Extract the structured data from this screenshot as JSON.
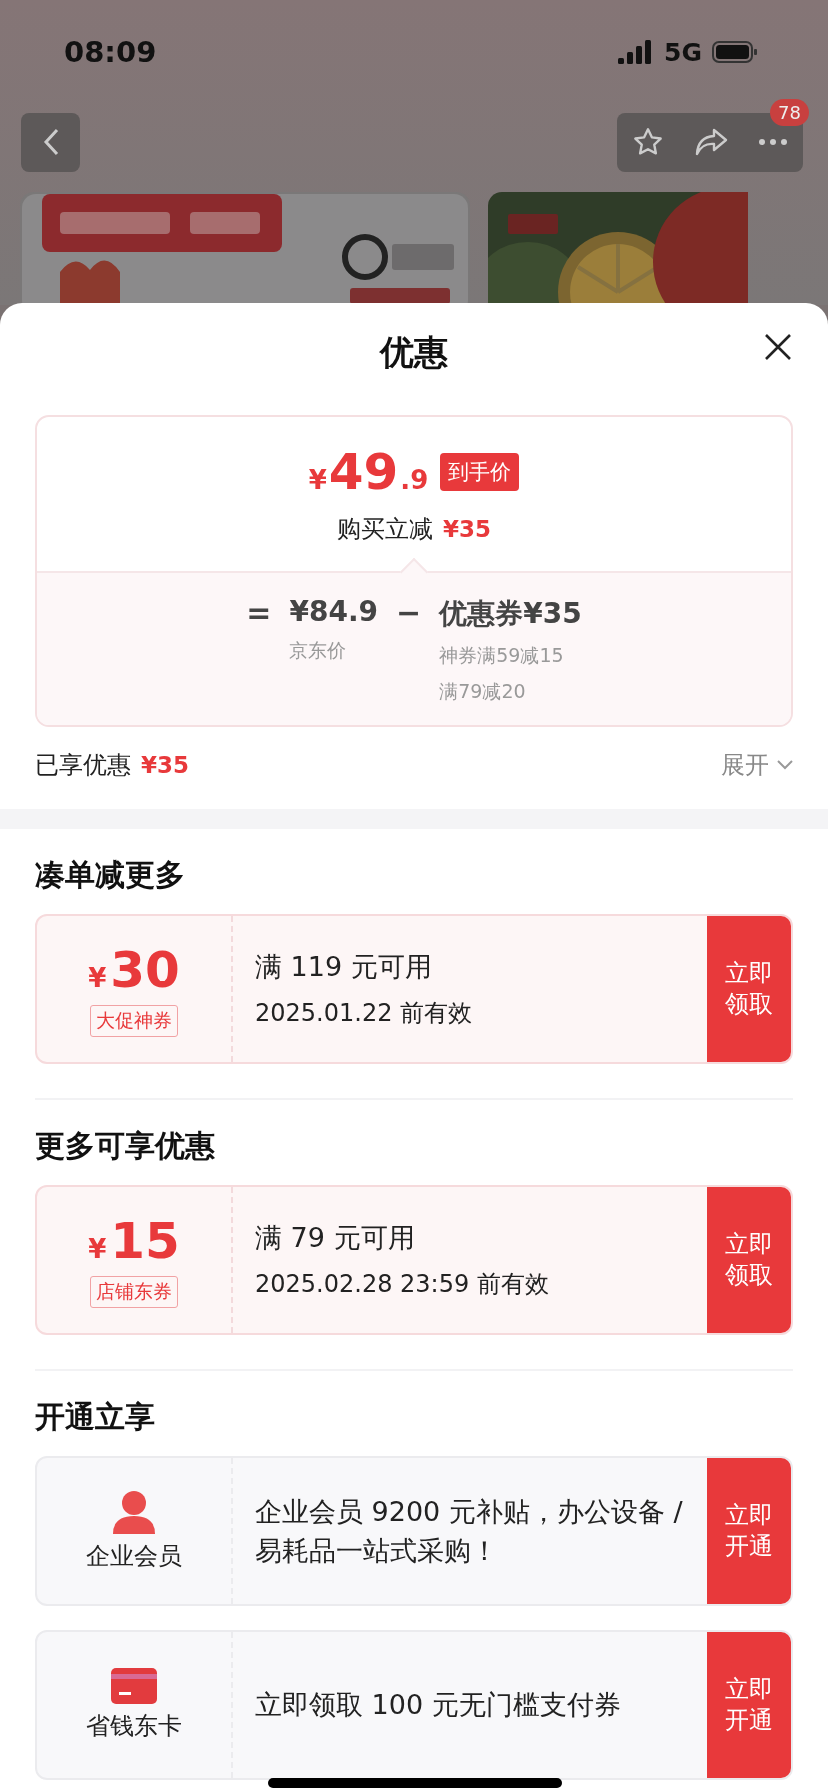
{
  "status_bar": {
    "time": "08:09",
    "network": "5G"
  },
  "nav": {
    "badge": "78"
  },
  "sheet": {
    "title": "优惠",
    "price_card": {
      "currency": "¥",
      "price_int": "49",
      "price_dec": ".9",
      "tag": "到手价",
      "cut_label": "购买立减",
      "cut_amount": "¥35",
      "equals": "=",
      "base_price": "¥84.9",
      "base_label": "京东价",
      "minus": "−",
      "coupon_label": "优惠券",
      "coupon_amount": "¥35",
      "coupon_details": [
        "神券满59减15",
        "满79减20"
      ]
    },
    "enjoyed": {
      "label": "已享优惠",
      "amount": "¥35"
    },
    "expand_label": "展开",
    "sections": [
      {
        "title": "凑单减更多",
        "items": [
          {
            "kind": "coupon",
            "currency": "¥",
            "amount": "30",
            "tag": "大促神券",
            "condition": "满 119 元可用",
            "validity": "2025.01.22 前有效",
            "action": "立即领取"
          }
        ]
      },
      {
        "title": "更多可享优惠",
        "items": [
          {
            "kind": "coupon",
            "currency": "¥",
            "amount": "15",
            "tag": "店铺东券",
            "condition": "满 79 元可用",
            "validity": "2025.02.28 23:59 前有效",
            "action": "立即领取"
          }
        ]
      },
      {
        "title": "开通立享",
        "items": [
          {
            "kind": "member",
            "name": "企业会员",
            "text": "企业会员 9200 元补贴，办公设备 / 易耗品一站式采购！",
            "action": "立即开通"
          },
          {
            "kind": "card",
            "name": "省钱东卡",
            "text": "立即领取 100 元无门槛支付券",
            "action": "立即开通"
          }
        ]
      }
    ]
  }
}
